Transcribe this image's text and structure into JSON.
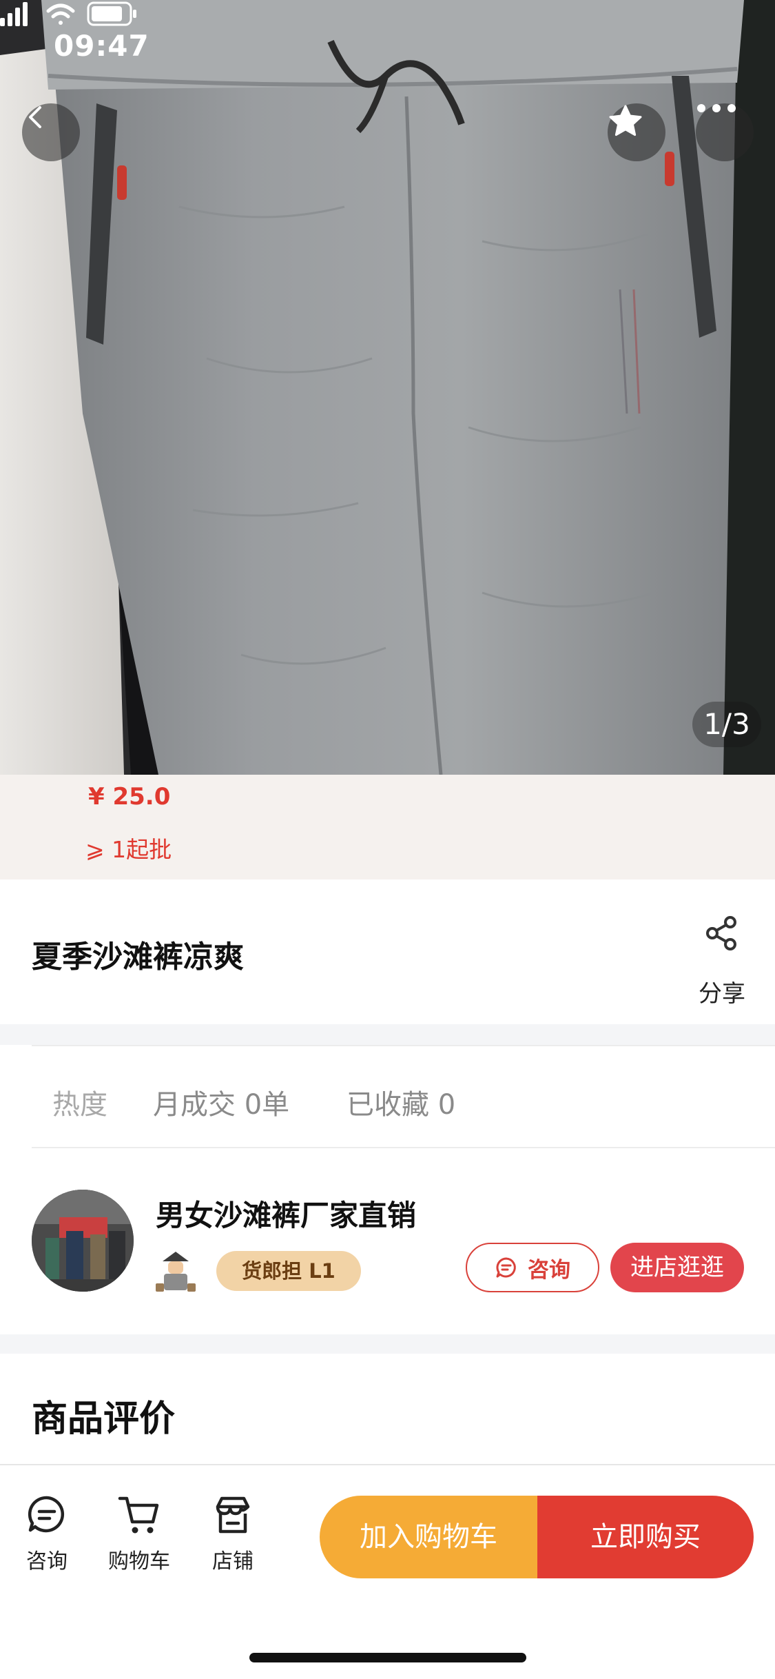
{
  "status_bar": {
    "time": "09:47"
  },
  "hero": {
    "image_counter": "1/3"
  },
  "price": {
    "value": "¥ 25.0",
    "min_order": "⩾ 1起批"
  },
  "product": {
    "title": "夏季沙滩裤凉爽",
    "share_label": "分享"
  },
  "stats": {
    "heat_label": "热度",
    "monthly_deals": "月成交 0单",
    "favorites": "已收藏 0"
  },
  "shop": {
    "name": "男女沙滩裤厂家直销",
    "badge": "货郎担 L1",
    "consult_label": "咨询",
    "enter_label": "进店逛逛"
  },
  "reviews": {
    "title": "商品评价"
  },
  "bottom_bar": {
    "consult": "咨询",
    "cart": "购物车",
    "shop": "店铺",
    "add_to_cart": "加入购物车",
    "buy_now": "立即购买"
  },
  "colors": {
    "price_red": "#e0392f",
    "enter_shop": "#e2454c",
    "add_cart": "#f5ab36",
    "buy_now": "#e13c32",
    "badge_bg": "#f2d3a6"
  },
  "icons": [
    "back-icon",
    "star-icon",
    "more-icon",
    "share-icon",
    "chat-icon",
    "cart-icon",
    "store-icon",
    "signal-icon",
    "wifi-icon",
    "battery-icon"
  ]
}
